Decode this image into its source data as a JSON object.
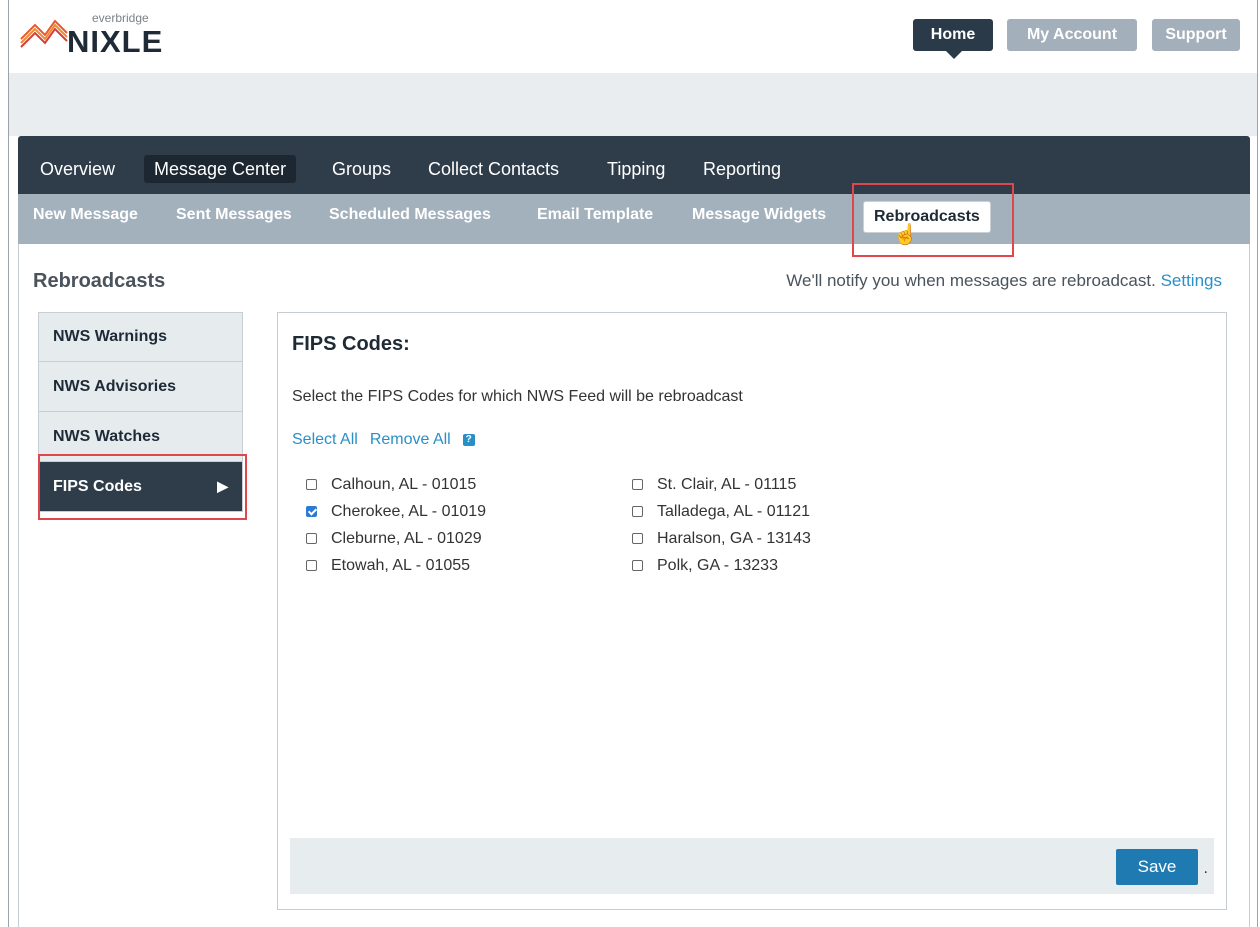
{
  "brand": {
    "small": "everbridge",
    "name": "NIXLE"
  },
  "top_nav": {
    "home": "Home",
    "account": "My Account",
    "support": "Support"
  },
  "main_nav": [
    "Overview",
    "Message Center",
    "Groups",
    "Collect Contacts",
    "Tipping",
    "Reporting"
  ],
  "sub_nav": [
    "New Message",
    "Sent Messages",
    "Scheduled Messages",
    "Email Template",
    "Message Widgets",
    "Rebroadcasts"
  ],
  "page": {
    "title": "Rebroadcasts",
    "notify_text": "We'll notify you when messages are rebroadcast.",
    "settings_link": "Settings"
  },
  "sidebar": [
    "NWS Warnings",
    "NWS Advisories",
    "NWS Watches",
    "FIPS Codes"
  ],
  "panel": {
    "title": "FIPS Codes:",
    "description": "Select the FIPS Codes for which NWS Feed will be rebroadcast",
    "select_all": "Select All",
    "remove_all": "Remove All",
    "help_icon": "?",
    "save": "Save",
    "trailing_dot": "."
  },
  "fips_left": [
    {
      "label": "Calhoun, AL - 01015",
      "checked": false
    },
    {
      "label": "Cherokee, AL - 01019",
      "checked": true
    },
    {
      "label": "Cleburne, AL - 01029",
      "checked": false
    },
    {
      "label": "Etowah, AL - 01055",
      "checked": false
    }
  ],
  "fips_right": [
    {
      "label": "St. Clair, AL - 01115",
      "checked": false
    },
    {
      "label": "Talladega, AL - 01121",
      "checked": false
    },
    {
      "label": "Haralson, GA - 13143",
      "checked": false
    },
    {
      "label": "Polk, GA - 13233",
      "checked": false
    }
  ],
  "colors": {
    "nav_dark": "#2f3d4b",
    "link_blue": "#2a8fc7",
    "highlight": "#e0474c",
    "save_blue": "#1e7ab0"
  }
}
